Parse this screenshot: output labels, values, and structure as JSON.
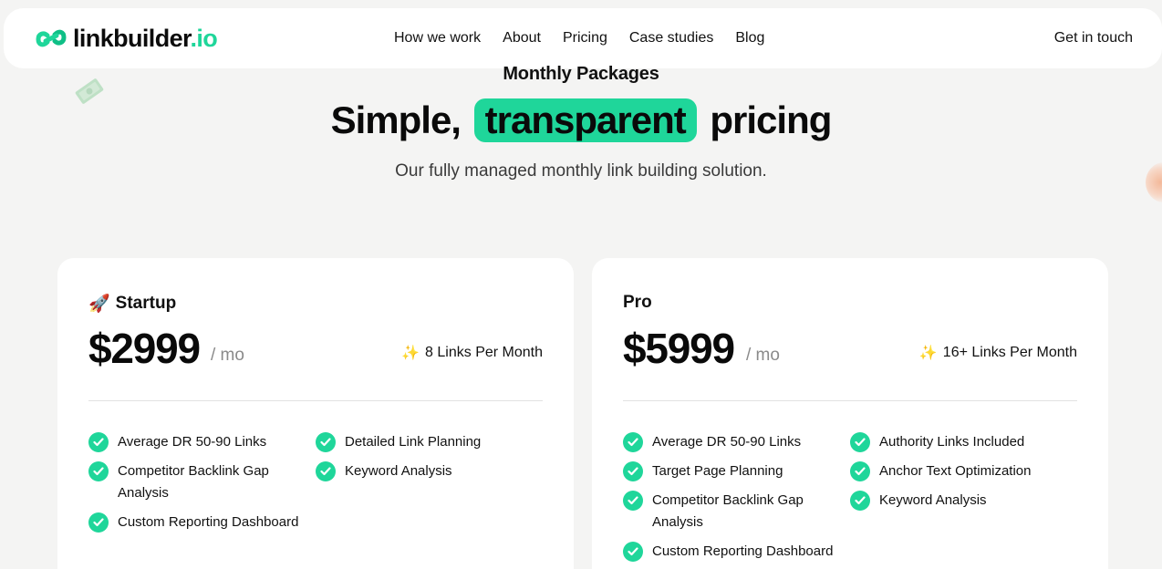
{
  "nav": {
    "logo_main": "linkbuilder",
    "logo_tld": ".io",
    "links": [
      "How we work",
      "About",
      "Pricing",
      "Case studies",
      "Blog"
    ],
    "cta": "Get in touch"
  },
  "hero": {
    "eyebrow": "Monthly Packages",
    "headline_before": "Simple,",
    "headline_highlight": "transparent",
    "headline_after": "pricing",
    "subtitle": "Our fully managed monthly link building solution."
  },
  "plans": [
    {
      "name": "Startup",
      "icon": "rocket-icon",
      "emoji": "🚀",
      "price": "$2999",
      "period": "/ mo",
      "links_label": "8 Links Per Month",
      "features_left": [
        "Average DR 50-90 Links",
        "Competitor Backlink Gap Analysis",
        "Custom Reporting Dashboard"
      ],
      "features_right": [
        "Detailed Link Planning",
        "Keyword Analysis"
      ]
    },
    {
      "name": "Pro",
      "price": "$5999",
      "period": "/ mo",
      "links_label": "16+ Links Per Month",
      "features_left": [
        "Average DR 50-90 Links",
        "Target Page Planning",
        "Competitor Backlink Gap Analysis",
        "Custom Reporting Dashboard"
      ],
      "features_right": [
        "Authority Links Included",
        "Anchor Text Optimization",
        "Keyword Analysis"
      ]
    }
  ],
  "colors": {
    "accent": "#1fd69a",
    "background": "#f4f4f3",
    "card": "#ffffff"
  },
  "sparkle": "✨"
}
